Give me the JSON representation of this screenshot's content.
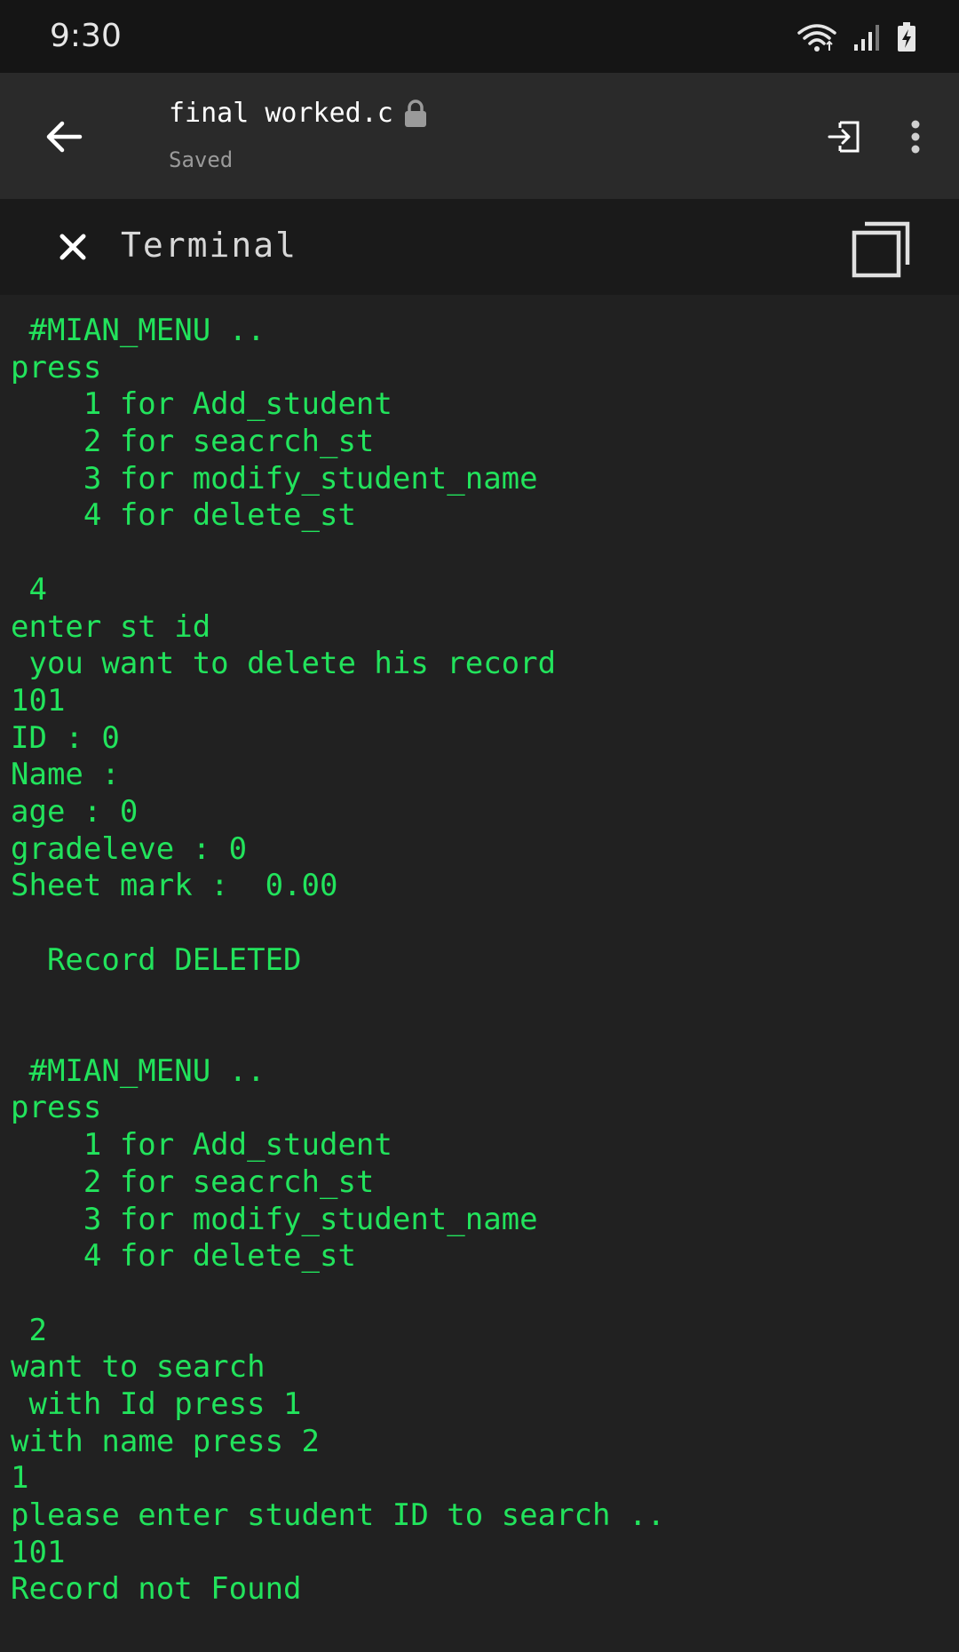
{
  "status_bar": {
    "time": "9:30",
    "icons": [
      "wifi-icon",
      "signal-icon",
      "battery-charging-icon"
    ]
  },
  "app_bar": {
    "file_name": "final worked.c",
    "file_status": "Saved",
    "icons": [
      "back-arrow-icon",
      "lock-icon",
      "exit-icon",
      "more-vert-icon"
    ]
  },
  "terminal_bar": {
    "title": "Terminal",
    "icons": [
      "close-icon",
      "windows-icon"
    ]
  },
  "terminal": {
    "text_color": "#22e35c",
    "lines": [
      " #MIAN_MENU ..",
      "press",
      "    1 for Add_student",
      "    2 for seacrch_st",
      "    3 for modify_student_name",
      "    4 for delete_st",
      "",
      " 4",
      "enter st id",
      " you want to delete his record",
      "101",
      "ID : 0",
      "Name :",
      "age : 0",
      "gradeleve : 0",
      "Sheet mark :  0.00",
      "",
      "  Record DELETED",
      "",
      "",
      " #MIAN_MENU ..",
      "press",
      "    1 for Add_student",
      "    2 for seacrch_st",
      "    3 for modify_student_name",
      "    4 for delete_st",
      "",
      " 2",
      "want to search",
      " with Id press 1",
      "with name press 2",
      "1",
      "please enter student ID to search ..",
      "101",
      "Record not Found"
    ]
  }
}
